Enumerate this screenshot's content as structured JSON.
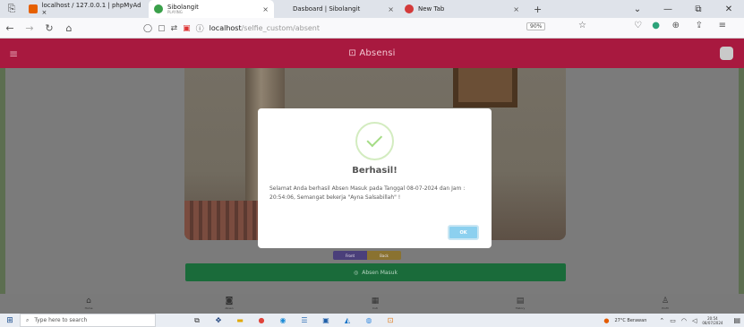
{
  "browser": {
    "tabs": [
      {
        "title": "localhost / 127.0.0.1 | phpMyAd ×",
        "favicon_color": "#e66000",
        "active": false
      },
      {
        "title": "Sibolangit",
        "subtitle": "PLAYING",
        "favicon_color": "#3aa04a",
        "active": true
      },
      {
        "title": "Dasboard | Sibolangit",
        "favicon_color": "#777777",
        "active": false
      },
      {
        "title": "New Tab",
        "favicon_color": "#d33a3a",
        "active": false
      }
    ],
    "tab_close_symbol": "×",
    "new_tab_symbol": "+",
    "url_host": "localhost",
    "url_path": "/selfie_custom/absent",
    "zoom": "90%",
    "window_controls": [
      "⌄",
      "—",
      "⧉",
      "✕"
    ]
  },
  "app": {
    "title": "Absensi",
    "header_color": "#a8193f",
    "menu_icon": "hamburger-icon",
    "title_icon": "camera-icon"
  },
  "camera": {
    "front_label": "Front",
    "back_label": "Back"
  },
  "absen_button": {
    "label": "Absen Masuk",
    "color": "#1a6b3a"
  },
  "modal": {
    "title": "Berhasil!",
    "message": "Selamat Anda berhasil Absen Masuk pada Tanggal 08-07-2024 dan Jam : 20:54:06, Semangat bekerja \"Ayna Salsabillah\" !",
    "ok_label": "OK",
    "icon": "success-check-icon"
  },
  "bottom_nav": [
    {
      "label": "Home",
      "icon": "home-icon"
    },
    {
      "label": "Absen",
      "icon": "camera-icon"
    },
    {
      "label": "Cuti",
      "icon": "calendar-icon"
    },
    {
      "label": "History",
      "icon": "document-icon"
    },
    {
      "label": "Profil",
      "icon": "user-icon"
    }
  ],
  "taskbar": {
    "search_placeholder": "Type here to search",
    "weather": "27°C Berawan",
    "time": "20:54",
    "date": "08/07/2024"
  }
}
